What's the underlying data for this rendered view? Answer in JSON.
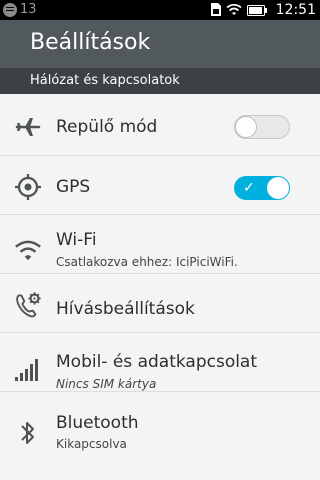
{
  "status_bar": {
    "notification_count": "13",
    "time": "12:51"
  },
  "header": {
    "title": "Beállítások"
  },
  "section": {
    "title": "Hálózat és kapcsolatok"
  },
  "settings": [
    {
      "label": "Repülő mód",
      "toggle": "off"
    },
    {
      "label": "GPS",
      "toggle": "on"
    },
    {
      "label": "Wi-Fi",
      "sub": "Csatlakozva ehhez: IciPiciWiFi."
    },
    {
      "label": "Hívásbeállítások"
    },
    {
      "label": "Mobil- és adatkapcsolat",
      "sub": "Nincs SIM kártya"
    },
    {
      "label": "Bluetooth",
      "sub": "Kikapcsolva"
    }
  ],
  "colors": {
    "header": "#52595d",
    "section": "#3b4145",
    "accent": "#00b1e0",
    "background": "#f4f4f4"
  },
  "icons": [
    "notification-icon",
    "sim-icon",
    "wifi-icon",
    "battery-icon",
    "airplane-icon",
    "gps-icon",
    "wifi-icon",
    "call-settings-icon",
    "signal-icon",
    "bluetooth-icon"
  ]
}
